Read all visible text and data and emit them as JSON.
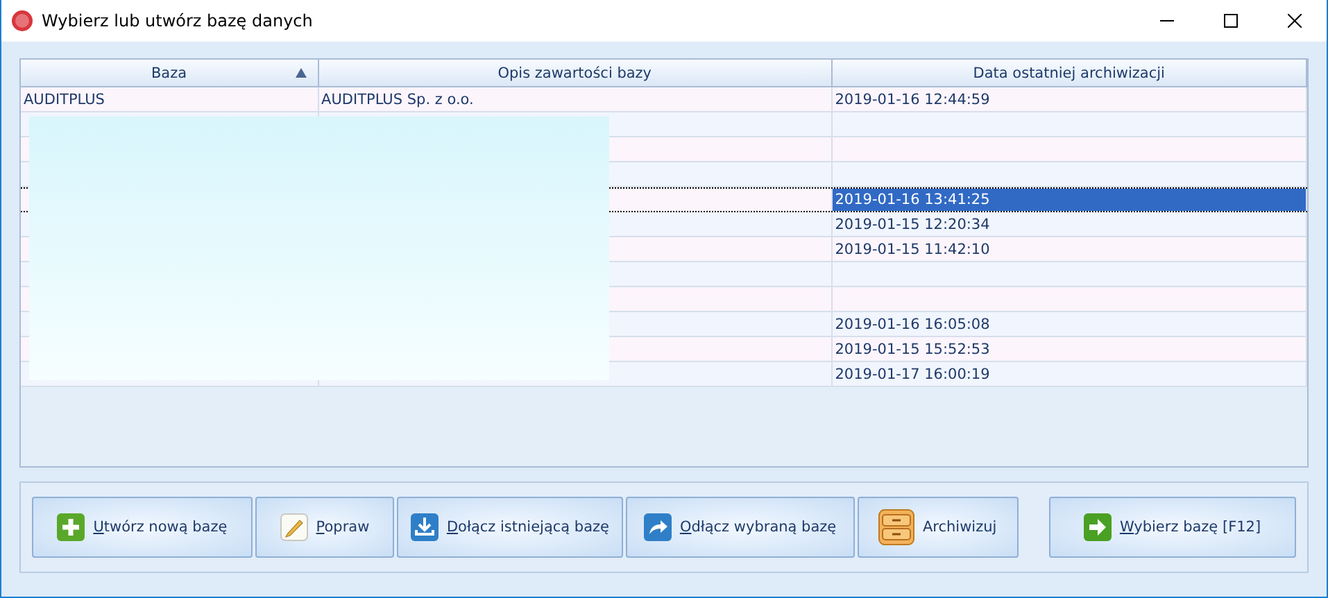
{
  "window": {
    "title": "Wybierz lub utwórz bazę danych"
  },
  "table": {
    "columns": [
      {
        "label": "Baza",
        "sorted": true
      },
      {
        "label": "Opis zawartości bazy",
        "sorted": false
      },
      {
        "label": "Data ostatniej archiwizacji",
        "sorted": false
      }
    ],
    "rows": [
      {
        "baza": "AUDITPLUS",
        "opis": "AUDITPLUS Sp. z o.o.",
        "data": "2019-01-16 12:44:59",
        "selected": false
      },
      {
        "data": "",
        "selected": false
      },
      {
        "data": "",
        "selected": false
      },
      {
        "data": "",
        "selected": false
      },
      {
        "data": "2019-01-16 13:41:25",
        "selected": true
      },
      {
        "data": "2019-01-15 12:20:34",
        "selected": false
      },
      {
        "data": "2019-01-15 11:42:10",
        "selected": false
      },
      {
        "data": "",
        "selected": false
      },
      {
        "data": "",
        "selected": false
      },
      {
        "data": "2019-01-16 16:05:08",
        "selected": false
      },
      {
        "data": "2019-01-15 15:52:53",
        "selected": false
      },
      {
        "data": "2019-01-17 16:00:19",
        "selected": false
      }
    ],
    "redacted": true
  },
  "buttons": [
    {
      "label": "Utwórz nową bazę",
      "underline_first": true
    },
    {
      "label": "Popraw",
      "underline_first": true
    },
    {
      "label": "Dołącz istniejącą bazę",
      "underline_first": true
    },
    {
      "label": "Odłącz wybraną bazę",
      "underline_first": true
    },
    {
      "label": "Archiwizuj",
      "underline_first": false
    },
    {
      "label": "Wybierz bazę [F12]",
      "underline_first": true
    }
  ]
}
